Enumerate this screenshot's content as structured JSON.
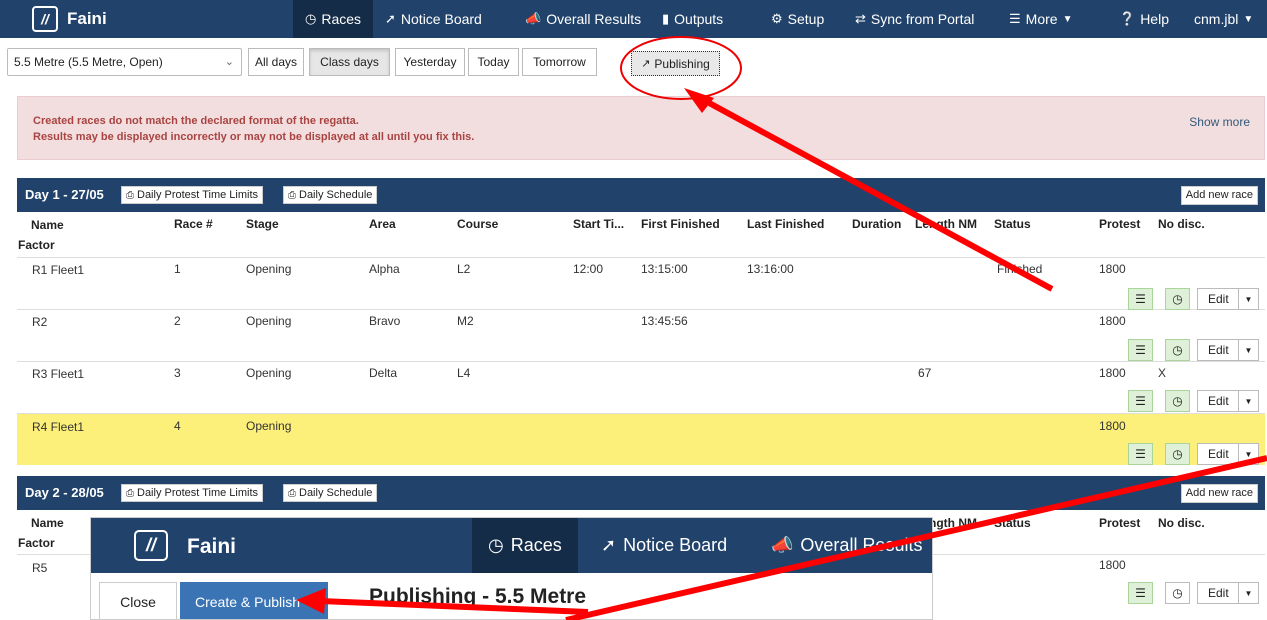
{
  "app": {
    "name": "Faini",
    "logo": "//"
  },
  "nav": {
    "races": "Races",
    "notice_board": "Notice Board",
    "overall_results": "Overall Results",
    "outputs": "Outputs",
    "setup": "Setup",
    "sync": "Sync from Portal",
    "more": "More",
    "help": "Help",
    "user": "cnm.jbl",
    "icons": {
      "races": "clock-icon",
      "notice_board": "pin-icon",
      "overall_results": "megaphone-icon",
      "outputs": "file-icon",
      "setup": "gear-icon",
      "sync": "sync-icon",
      "more": "menu-icon",
      "help": "question-icon"
    }
  },
  "toolbar": {
    "class_select": "5.5 Metre (5.5 Metre, Open)",
    "filters": [
      "All days",
      "Class days",
      "Yesterday",
      "Today",
      "Tomorrow"
    ],
    "active_filter": "Class days",
    "publishing": "Publishing"
  },
  "alert": {
    "line1": "Created races do not match the declared format of the regatta.",
    "line2": "Results may be displayed incorrectly or may not be displayed at all until you fix this.",
    "show_more": "Show more"
  },
  "columns": {
    "name": "Name",
    "factor": "Factor",
    "race_no": "Race #",
    "stage": "Stage",
    "area": "Area",
    "course": "Course",
    "start_time": "Start Ti...",
    "first_finished": "First Finished",
    "last_finished": "Last Finished",
    "duration": "Duration",
    "length_nm": "Length NM",
    "status": "Status",
    "protest": "Protest",
    "no_disc": "No disc."
  },
  "buttons": {
    "protest_limits": "Daily Protest Time Limits",
    "schedule": "Daily Schedule",
    "add_race": "Add new race",
    "edit": "Edit"
  },
  "days": [
    {
      "title": "Day 1 - 27/05",
      "races": [
        {
          "name": "R1 Fleet1",
          "race_no": "1",
          "stage": "Opening",
          "area": "Alpha",
          "course": "L2",
          "start": "12:00",
          "first": "13:15:00",
          "last": "13:16:00",
          "duration": "",
          "length": "",
          "status": "Finished",
          "protest": "1800",
          "no_disc": ""
        },
        {
          "name": "R2",
          "race_no": "2",
          "stage": "Opening",
          "area": "Bravo",
          "course": "M2",
          "start": "",
          "first": "13:45:56",
          "last": "",
          "duration": "",
          "length": "",
          "status": "",
          "protest": "1800",
          "no_disc": ""
        },
        {
          "name": "R3 Fleet1",
          "race_no": "3",
          "stage": "Opening",
          "area": "Delta",
          "course": "L4",
          "start": "",
          "first": "",
          "last": "",
          "duration": "",
          "length": "67",
          "status": "",
          "protest": "1800",
          "no_disc": "X"
        },
        {
          "name": "R4 Fleet1",
          "race_no": "4",
          "stage": "Opening",
          "area": "",
          "course": "",
          "start": "",
          "first": "",
          "last": "",
          "duration": "",
          "length": "",
          "status": "",
          "protest": "1800",
          "no_disc": ""
        }
      ]
    },
    {
      "title": "Day 2 - 28/05",
      "races": [
        {
          "name": "R5",
          "protest": "1800"
        }
      ]
    }
  ],
  "overlay": {
    "brand": "Faini",
    "races": "Races",
    "notice_board": "Notice Board",
    "overall_results": "Overall Results",
    "close": "Close",
    "create_publish": "Create & Publish",
    "title": "Publishing - 5.5 Metre"
  },
  "annotation_color": "#ff0000"
}
